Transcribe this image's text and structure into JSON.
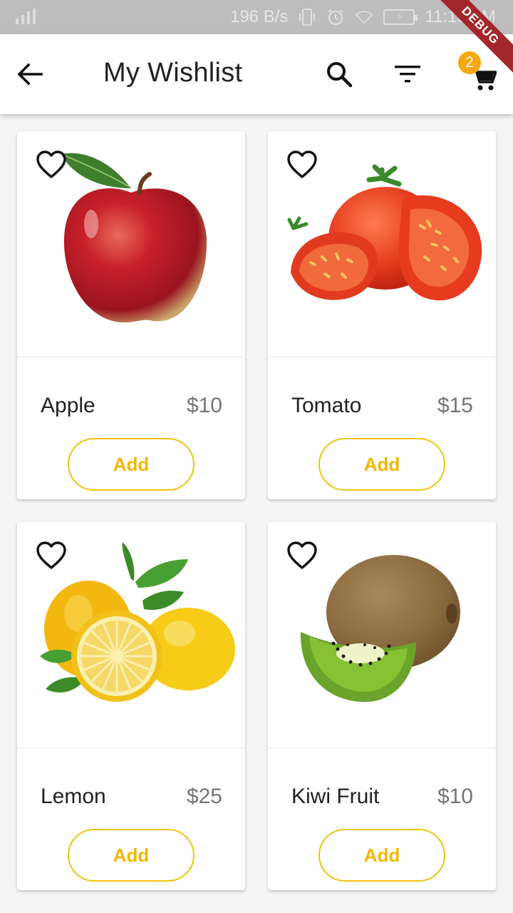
{
  "status_bar": {
    "net_speed": "196 B/s",
    "time": "11:15 AM"
  },
  "debug_banner": "DEBUG",
  "app_bar": {
    "title": "My Wishlist",
    "cart_count": "2"
  },
  "colors": {
    "accent": "#f2b705",
    "badge": "#f7a80e"
  },
  "icons": {
    "back": "arrow-left-icon",
    "search": "search-icon",
    "filter": "filter-icon",
    "cart": "cart-icon",
    "favorite": "heart-outline-icon"
  },
  "products": [
    {
      "name": "Apple",
      "price": "$10",
      "button": "Add"
    },
    {
      "name": "Tomato",
      "price": "$15",
      "button": "Add"
    },
    {
      "name": "Lemon",
      "price": "$25",
      "button": "Add"
    },
    {
      "name": "Kiwi Fruit",
      "price": "$10",
      "button": "Add"
    }
  ]
}
